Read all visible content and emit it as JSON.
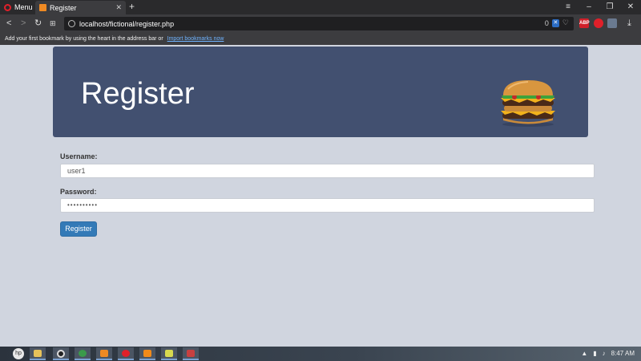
{
  "browser": {
    "menu_label": "Menu",
    "tab_title": "Register",
    "url": "localhost/fictional/register.php",
    "url_badge": "0",
    "window_controls": [
      "minimize-icon",
      "restore-icon",
      "close-icon"
    ],
    "extensions": [
      {
        "name": "adblock-icon",
        "label": "ABP",
        "color": "#d0202a"
      },
      {
        "name": "opera-vpn-icon",
        "label": "",
        "color": "#e0202a"
      },
      {
        "name": "snapshot-icon",
        "label": "",
        "color": "#6a7a90"
      }
    ]
  },
  "bookmarks_bar": {
    "text": "Add your first bookmark by using the heart in the address bar or",
    "link": "Import bookmarks now"
  },
  "page": {
    "banner_title": "Register",
    "banner_color": "#425070",
    "username_label": "Username:",
    "username_value": "user1",
    "password_label": "Password:",
    "password_value": "••••••••••",
    "submit_label": "Register",
    "button_color": "#337ab7"
  },
  "taskbar": {
    "apps": [
      "file-explorer-icon",
      "opera-gx-icon",
      "chrome-icon",
      "xampp-icon",
      "opera-icon",
      "vlc-icon",
      "notepad-icon",
      "paint-icon"
    ],
    "clock": "8:47 AM"
  }
}
